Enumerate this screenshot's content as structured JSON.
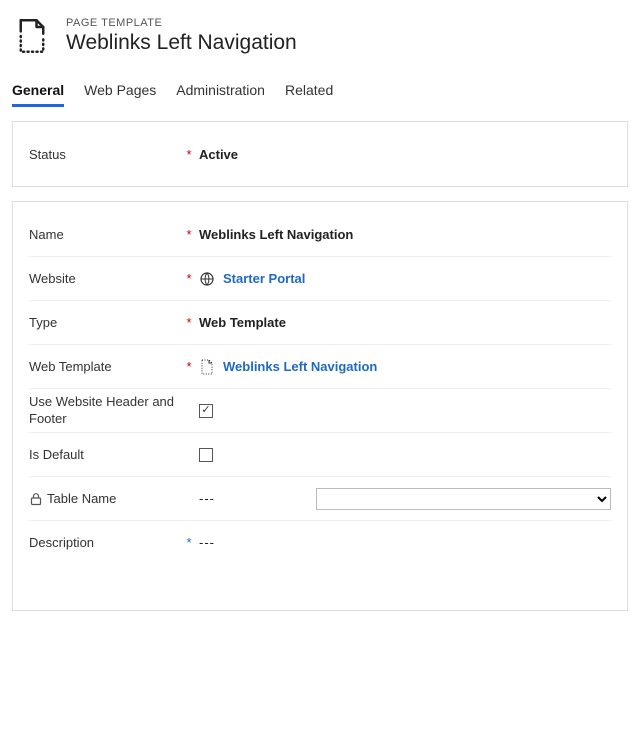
{
  "header": {
    "entity": "PAGE TEMPLATE",
    "title": "Weblinks Left Navigation"
  },
  "tabs": {
    "general": "General",
    "web_pages": "Web Pages",
    "administration": "Administration",
    "related": "Related"
  },
  "status_section": {
    "status_label": "Status",
    "status_value": "Active"
  },
  "fields": {
    "name_label": "Name",
    "name_value": "Weblinks Left Navigation",
    "website_label": "Website",
    "website_value": "Starter Portal",
    "type_label": "Type",
    "type_value": "Web Template",
    "web_template_label": "Web Template",
    "web_template_value": "Weblinks Left Navigation",
    "use_header_footer_label": "Use Website Header and Footer",
    "use_header_footer_checked": true,
    "is_default_label": "Is Default",
    "is_default_checked": false,
    "table_name_label": "Table Name",
    "table_name_value": "---",
    "table_name_dropdown_value": "",
    "description_label": "Description",
    "description_value": "---"
  },
  "required_mark": "*"
}
